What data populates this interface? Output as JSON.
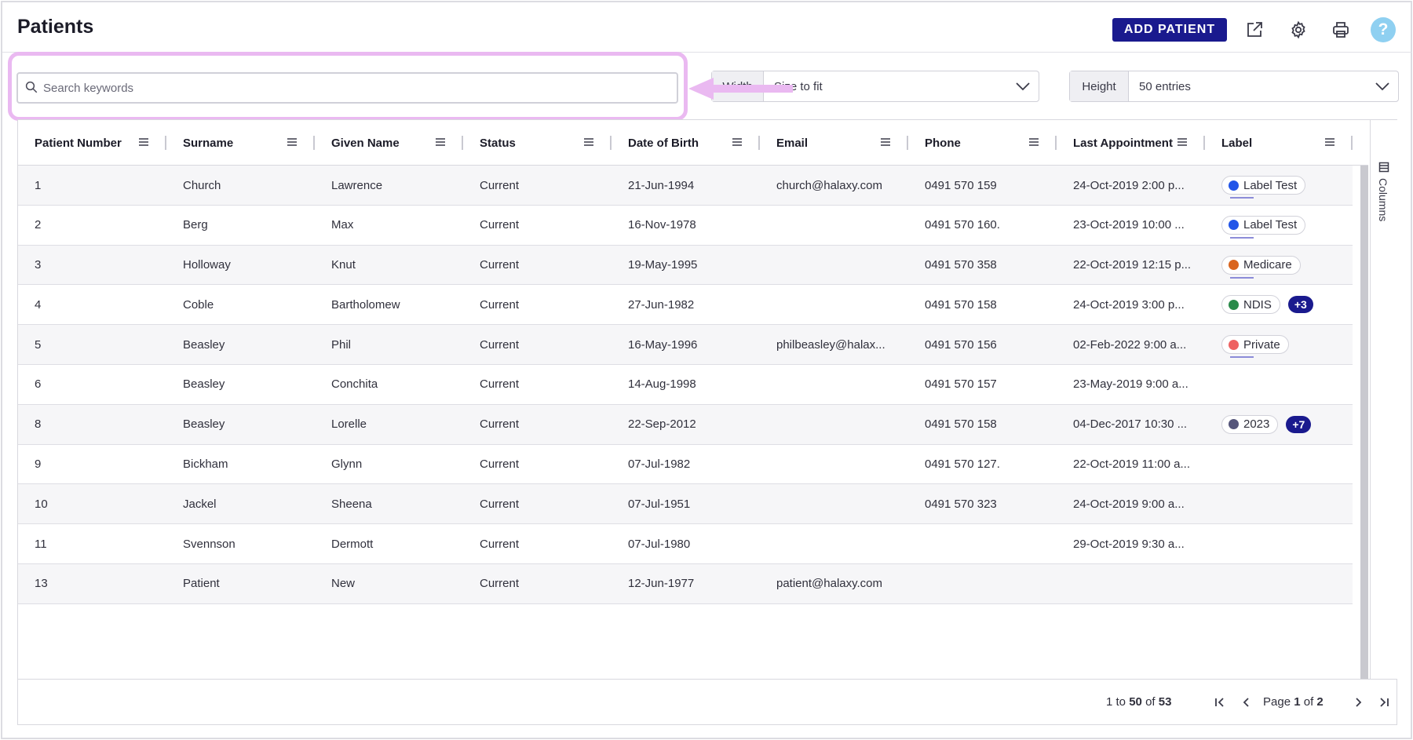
{
  "header": {
    "title": "Patients",
    "add_button": "ADD PATIENT",
    "help": "?"
  },
  "toolbar": {
    "search_placeholder": "Search keywords",
    "width_label": "Width",
    "width_value": "Size to fit",
    "height_label": "Height",
    "height_value": "50 entries"
  },
  "table": {
    "columns": [
      "Patient Number",
      "Surname",
      "Given Name",
      "Status",
      "Date of Birth",
      "Email",
      "Phone",
      "Last Appointment",
      "Label"
    ],
    "rows": [
      {
        "num": "1",
        "surname": "Church",
        "given": "Lawrence",
        "status": "Current",
        "dob": "21-Jun-1994",
        "email": "church@halaxy.com",
        "phone": "0491 570 159",
        "last": "24-Oct-2019 2:00 p...",
        "label": "Label Test",
        "label_color": "#2255e8",
        "more": ""
      },
      {
        "num": "2",
        "surname": "Berg",
        "given": "Max",
        "status": "Current",
        "dob": "16-Nov-1978",
        "email": "",
        "phone": "0491 570 160.",
        "last": "23-Oct-2019 10:00 ...",
        "label": "Label Test",
        "label_color": "#2255e8",
        "more": ""
      },
      {
        "num": "3",
        "surname": "Holloway",
        "given": "Knut",
        "status": "Current",
        "dob": "19-May-1995",
        "email": "",
        "phone": "0491 570 358",
        "last": "22-Oct-2019 12:15 p...",
        "label": "Medicare",
        "label_color": "#d9641e",
        "more": ""
      },
      {
        "num": "4",
        "surname": "Coble",
        "given": "Bartholomew",
        "status": "Current",
        "dob": "27-Jun-1982",
        "email": "",
        "phone": "0491 570 158",
        "last": "24-Oct-2019 3:00 p...",
        "label": "NDIS",
        "label_color": "#2a8a4a",
        "more": "+3"
      },
      {
        "num": "5",
        "surname": "Beasley",
        "given": "Phil",
        "status": "Current",
        "dob": "16-May-1996",
        "email": "philbeasley@halax...",
        "phone": "0491 570 156",
        "last": "02-Feb-2022 9:00 a...",
        "label": "Private",
        "label_color": "#ee6262",
        "more": ""
      },
      {
        "num": "6",
        "surname": "Beasley",
        "given": "Conchita",
        "status": "Current",
        "dob": "14-Aug-1998",
        "email": "",
        "phone": "0491 570 157",
        "last": "23-May-2019 9:00 a...",
        "label": "",
        "label_color": "",
        "more": ""
      },
      {
        "num": "8",
        "surname": "Beasley",
        "given": "Lorelle",
        "status": "Current",
        "dob": "22-Sep-2012",
        "email": "",
        "phone": "0491 570 158",
        "last": "04-Dec-2017 10:30 ...",
        "label": "2023",
        "label_color": "#55557a",
        "more": "+7"
      },
      {
        "num": "9",
        "surname": "Bickham",
        "given": "Glynn",
        "status": "Current",
        "dob": "07-Jul-1982",
        "email": "",
        "phone": "0491 570 127.",
        "last": "22-Oct-2019 11:00 a...",
        "label": "",
        "label_color": "",
        "more": ""
      },
      {
        "num": "10",
        "surname": "Jackel",
        "given": "Sheena",
        "status": "Current",
        "dob": "07-Jul-1951",
        "email": "",
        "phone": "0491 570 323",
        "last": "24-Oct-2019 9:00 a...",
        "label": "",
        "label_color": "",
        "more": ""
      },
      {
        "num": "11",
        "surname": "Svennson",
        "given": "Dermott",
        "status": "Current",
        "dob": "07-Jul-1980",
        "email": "",
        "phone": "",
        "last": "29-Oct-2019 9:30 a...",
        "label": "",
        "label_color": "",
        "more": ""
      },
      {
        "num": "13",
        "surname": "Patient",
        "given": "New",
        "status": "Current",
        "dob": "12-Jun-1977",
        "email": "patient@halaxy.com",
        "phone": "",
        "last": "",
        "label": "",
        "label_color": "",
        "more": ""
      }
    ]
  },
  "side_panel": {
    "columns_label": "Columns"
  },
  "pagination": {
    "from": "1",
    "to": "50",
    "of_label": "of",
    "to_label": "to",
    "total": "53",
    "page_label": "Page",
    "current_page": "1",
    "total_pages": "2"
  }
}
